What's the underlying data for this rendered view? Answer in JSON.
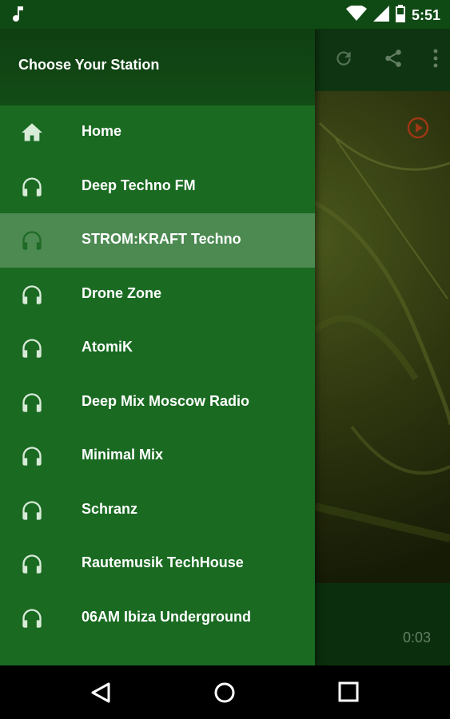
{
  "status_bar": {
    "time": "5:51",
    "icons": [
      "music-note-icon",
      "wifi-icon",
      "signal-icon",
      "battery-icon"
    ]
  },
  "app_bar": {
    "actions": [
      "refresh-icon",
      "share-icon",
      "more-vert-icon"
    ]
  },
  "player": {
    "elapsed": "0:03"
  },
  "drawer": {
    "title": "Choose Your Station",
    "stations": [
      {
        "label": "Home",
        "icon": "home-icon",
        "selected": false
      },
      {
        "label": "Deep Techno FM",
        "icon": "headphones-icon",
        "selected": false
      },
      {
        "label": "STROM:KRAFT Techno",
        "icon": "headphones-icon",
        "selected": true
      },
      {
        "label": "Drone Zone",
        "icon": "headphones-icon",
        "selected": false
      },
      {
        "label": "AtomiK",
        "icon": "headphones-icon",
        "selected": false
      },
      {
        "label": "Deep Mix Moscow Radio",
        "icon": "headphones-icon",
        "selected": false
      },
      {
        "label": "Minimal Mix",
        "icon": "headphones-icon",
        "selected": false
      },
      {
        "label": "Schranz",
        "icon": "headphones-icon",
        "selected": false
      },
      {
        "label": "Rautemusik TechHouse",
        "icon": "headphones-icon",
        "selected": false
      },
      {
        "label": "06AM Ibiza Underground",
        "icon": "headphones-icon",
        "selected": false
      }
    ]
  },
  "nav_bar": {
    "buttons": [
      "back-icon",
      "home-circle-icon",
      "recents-icon"
    ]
  },
  "colors": {
    "drawer": "#1a6a22",
    "header": "#0f3f12",
    "accent_play": "#c0441a"
  }
}
